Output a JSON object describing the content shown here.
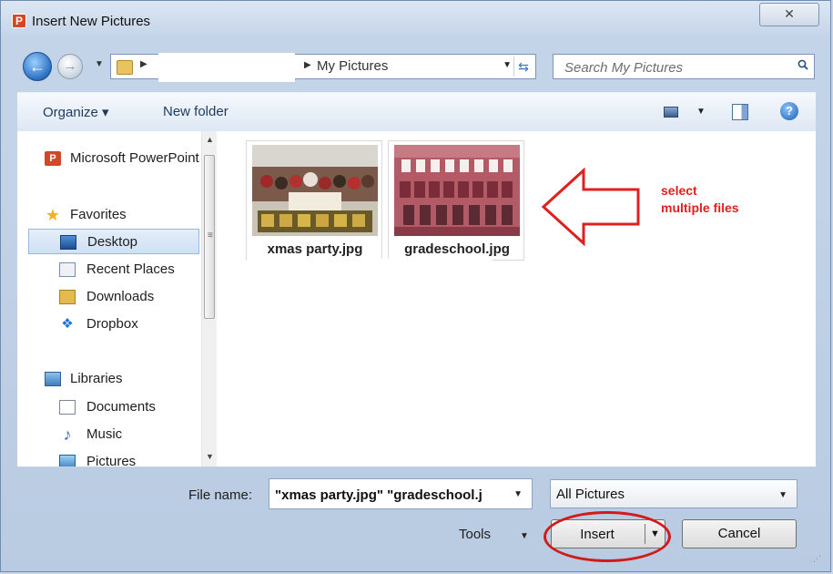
{
  "window": {
    "title": "Insert New Pictures",
    "close_glyph": "✕"
  },
  "address": {
    "current_folder": "My Pictures",
    "search_placeholder": "Search My Pictures"
  },
  "toolbar": {
    "organize_label": "Organize ▾",
    "new_folder_label": "New folder"
  },
  "nav": {
    "items": [
      {
        "label": "Microsoft PowerPoint",
        "icon": "powerpoint-icon"
      },
      {
        "label": "Favorites",
        "icon": "star-icon"
      },
      {
        "label": "Desktop",
        "icon": "desktop-icon",
        "selected": true
      },
      {
        "label": "Recent Places",
        "icon": "recent-places-icon"
      },
      {
        "label": "Downloads",
        "icon": "downloads-icon"
      },
      {
        "label": "Dropbox",
        "icon": "dropbox-icon"
      },
      {
        "label": "Libraries",
        "icon": "libraries-icon"
      },
      {
        "label": "Documents",
        "icon": "documents-icon"
      },
      {
        "label": "Music",
        "icon": "music-icon"
      },
      {
        "label": "Pictures",
        "icon": "pictures-icon"
      }
    ]
  },
  "files": [
    {
      "name": "xmas party.jpg"
    },
    {
      "name": "gradeschool.jpg"
    }
  ],
  "annotation": {
    "line1": "select",
    "line2": "multiple files",
    "color": "#e02020"
  },
  "footer": {
    "filename_label": "File name:",
    "filename_value": "\"xmas party.jpg\" \"gradeschool.j",
    "filter_value": "All Pictures",
    "tools_label": "Tools",
    "insert_label": "Insert",
    "cancel_label": "Cancel"
  }
}
